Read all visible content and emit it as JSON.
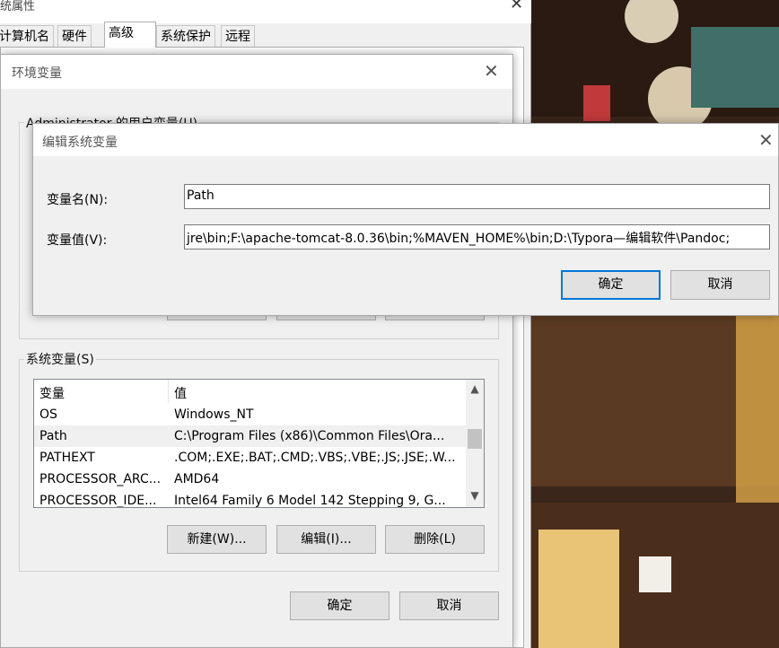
{
  "sys_props": {
    "title": "统属性",
    "tabs": [
      "计算机名",
      "硬件",
      "高级",
      "系统保护",
      "远程"
    ]
  },
  "env_dialog": {
    "title": "环境变量",
    "user_group_label": "Administrator 的用户变量(U)",
    "system_group_label": "系统变量(S)",
    "columns": [
      "变量",
      "值"
    ],
    "rows": [
      {
        "name": "OS",
        "value": "Windows_NT"
      },
      {
        "name": "Path",
        "value": "C:\\Program Files (x86)\\Common Files\\Ora..."
      },
      {
        "name": "PATHEXT",
        "value": ".COM;.EXE;.BAT;.CMD;.VBS;.VBE;.JS;.JSE;.W..."
      },
      {
        "name": "PROCESSOR_ARC...",
        "value": "AMD64"
      },
      {
        "name": "PROCESSOR_IDE...",
        "value": "Intel64 Family 6 Model 142 Stepping 9, G..."
      }
    ],
    "selected_row": "Path",
    "buttons": {
      "new": "新建(W)...",
      "edit": "编辑(I)...",
      "delete": "删除(L)"
    },
    "ok": "确定",
    "cancel": "取消"
  },
  "edit_dialog": {
    "title": "编辑系统变量",
    "name_label": "变量名(N):",
    "value_label": "变量值(V):",
    "name_value": "Path",
    "value_value": "jre\\bin;F:\\apache-tomcat-8.0.36\\bin;%MAVEN_HOME%\\bin;D:\\Typora—编辑软件\\Pandoc;",
    "ok": "确定",
    "cancel": "取消"
  },
  "icons": {
    "close": "close-icon",
    "scroll_up": "scroll-up-icon",
    "scroll_down": "scroll-down-icon"
  },
  "colors": {
    "focus_border": "#0078d7",
    "button_face": "#e1e1e1",
    "window_bg": "#f0f0f0"
  }
}
